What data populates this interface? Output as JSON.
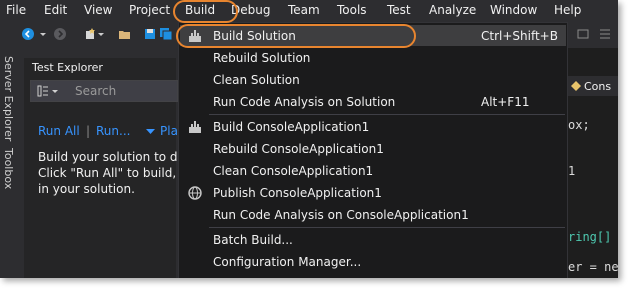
{
  "menubar": {
    "items": [
      "File",
      "Edit",
      "View",
      "Project",
      "Build",
      "Debug",
      "Team",
      "Tools",
      "Test",
      "Analyze",
      "Window",
      "Help"
    ]
  },
  "left_strip": {
    "tabs": [
      "Server Explorer",
      "Toolbox"
    ]
  },
  "test_explorer": {
    "title": "Test Explorer",
    "search_placeholder": "Search",
    "run_all": "Run All",
    "run": "Run...",
    "separator": "|",
    "playlist": "Play",
    "message_lines": [
      "Build your solution to disc",
      "Click \"Run All\" to build, dis",
      "in your solution."
    ]
  },
  "editor": {
    "tab_label": "Cons",
    "fragments": [
      "ox;",
      "1",
      "ring[]",
      "er = new"
    ]
  },
  "build_menu": {
    "items": [
      {
        "label": "Build Solution",
        "shortcut": "Ctrl+Shift+B",
        "icon": "build-solution-icon"
      },
      {
        "label": "Rebuild Solution",
        "shortcut": ""
      },
      {
        "label": "Clean Solution",
        "shortcut": ""
      },
      {
        "label": "Run Code Analysis on Solution",
        "shortcut": "Alt+F11"
      },
      {
        "label": "Build ConsoleApplication1",
        "shortcut": "",
        "icon": "build-project-icon"
      },
      {
        "label": "Rebuild ConsoleApplication1",
        "shortcut": ""
      },
      {
        "label": "Clean ConsoleApplication1",
        "shortcut": ""
      },
      {
        "label": "Publish ConsoleApplication1",
        "shortcut": "",
        "icon": "globe-icon"
      },
      {
        "label": "Run Code Analysis on ConsoleApplication1",
        "shortcut": ""
      },
      {
        "label": "Batch Build...",
        "shortcut": ""
      },
      {
        "label": "Configuration Manager...",
        "shortcut": ""
      }
    ]
  },
  "colors": {
    "background": "#2d2d30",
    "menu_background": "#1b1b1c",
    "highlight": "#3e3e40",
    "link": "#3794ff",
    "annotation": "#e8852f"
  }
}
